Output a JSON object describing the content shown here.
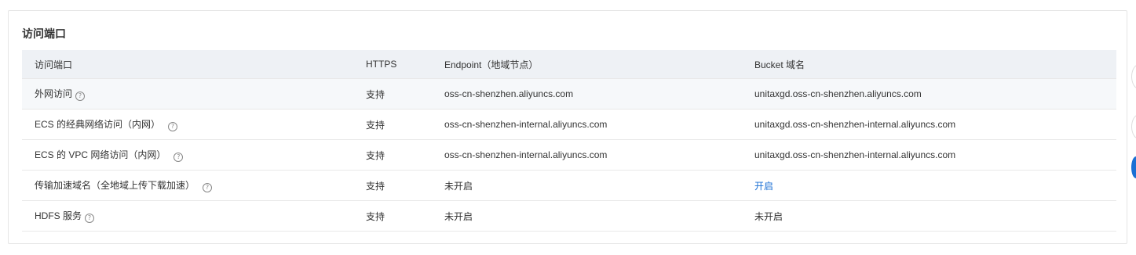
{
  "section": {
    "title": "访问端口"
  },
  "table": {
    "headers": {
      "port": "访问端口",
      "https": "HTTPS",
      "endpoint": "Endpoint（地域节点）",
      "bucket": "Bucket 域名"
    },
    "rows": [
      {
        "port": "外网访问",
        "https": "支持",
        "endpoint": "oss-cn-shenzhen.aliyuncs.com",
        "bucket": "unitaxgd.oss-cn-shenzhen.aliyuncs.com"
      },
      {
        "port": "ECS 的经典网络访问（内网）",
        "https": "支持",
        "endpoint": "oss-cn-shenzhen-internal.aliyuncs.com",
        "bucket": "unitaxgd.oss-cn-shenzhen-internal.aliyuncs.com"
      },
      {
        "port": "ECS 的 VPC 网络访问（内网）",
        "https": "支持",
        "endpoint": "oss-cn-shenzhen-internal.aliyuncs.com",
        "bucket": "unitaxgd.oss-cn-shenzhen-internal.aliyuncs.com"
      },
      {
        "port": "传输加速域名（全地域上传下载加速）",
        "https": "支持",
        "endpoint": "未开启",
        "bucket": "开启"
      },
      {
        "port": "HDFS 服务",
        "https": "支持",
        "endpoint": "未开启",
        "bucket": "未开启"
      }
    ]
  },
  "icons": {
    "help": "?"
  },
  "colors": {
    "support": "#2e9e3a",
    "link": "#1a6fd4",
    "header_bg": "#eef1f5"
  }
}
